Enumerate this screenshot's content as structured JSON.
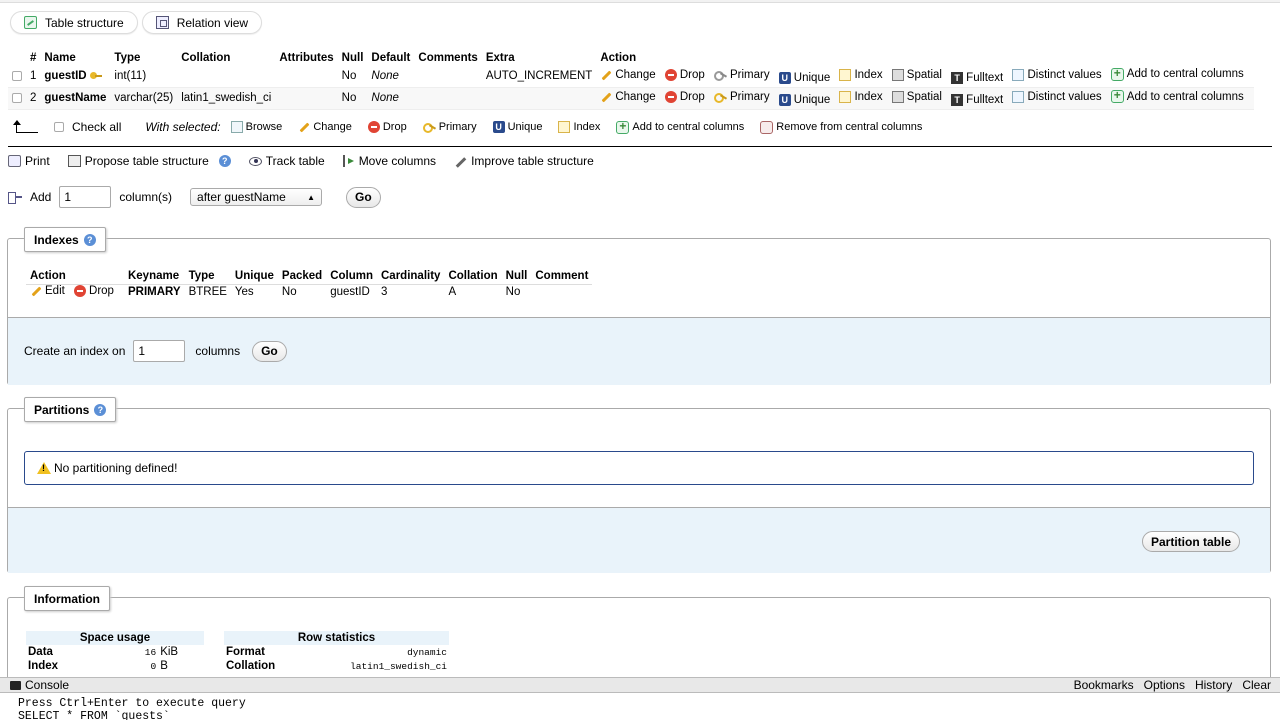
{
  "subtabs": [
    {
      "label": "Table structure",
      "icon": "structure-icon"
    },
    {
      "label": "Relation view",
      "icon": "relation-icon"
    }
  ],
  "structure": {
    "headers": [
      "#",
      "Name",
      "Type",
      "Collation",
      "Attributes",
      "Null",
      "Default",
      "Comments",
      "Extra",
      "Action"
    ],
    "rows": [
      {
        "num": "1",
        "name": "guestID",
        "type": "int(11)",
        "collation": "",
        "attributes": "",
        "null": "No",
        "default": "None",
        "comments": "",
        "extra": "AUTO_INCREMENT"
      },
      {
        "num": "2",
        "name": "guestName",
        "type": "varchar(25)",
        "collation": "latin1_swedish_ci",
        "attributes": "",
        "null": "No",
        "default": "None",
        "comments": "",
        "extra": ""
      }
    ],
    "actions": [
      "Change",
      "Drop",
      "Primary",
      "Unique",
      "Index",
      "Spatial",
      "Fulltext",
      "Distinct values",
      "Add to central columns"
    ]
  },
  "with_selected": {
    "check_all": "Check all",
    "label": "With selected:",
    "buttons": [
      "Browse",
      "Change",
      "Drop",
      "Primary",
      "Unique",
      "Index",
      "Add to central columns",
      "Remove from central columns"
    ]
  },
  "toollinks": [
    "Print",
    "Propose table structure",
    "Track table",
    "Move columns",
    "Improve table structure"
  ],
  "add_column": {
    "label": "Add",
    "value": "1",
    "suffix": "column(s)",
    "position": "after guestName",
    "go": "Go"
  },
  "indexes": {
    "legend": "Indexes",
    "headers": [
      "Action",
      "Keyname",
      "Type",
      "Unique",
      "Packed",
      "Column",
      "Cardinality",
      "Collation",
      "Null",
      "Comment"
    ],
    "row": {
      "edit": "Edit",
      "drop": "Drop",
      "keyname": "PRIMARY",
      "type": "BTREE",
      "unique": "Yes",
      "packed": "No",
      "column": "guestID",
      "cardinality": "3",
      "collation": "A",
      "null": "No",
      "comment": ""
    },
    "create": {
      "label": "Create an index on",
      "value": "1",
      "suffix": "columns",
      "go": "Go"
    }
  },
  "partitions": {
    "legend": "Partitions",
    "notice": "No partitioning defined!",
    "button": "Partition table"
  },
  "information": {
    "legend": "Information",
    "space_usage": {
      "title": "Space usage",
      "rows": [
        {
          "label": "Data",
          "value": "16",
          "unit": "KiB"
        },
        {
          "label": "Index",
          "value": "0",
          "unit": "B"
        }
      ]
    },
    "row_statistics": {
      "title": "Row statistics",
      "rows": [
        {
          "label": "Format",
          "value": "dynamic"
        },
        {
          "label": "Collation",
          "value": "latin1_swedish_ci"
        }
      ]
    }
  },
  "console": {
    "label": "Console",
    "links": [
      "Bookmarks",
      "Options",
      "History",
      "Clear"
    ],
    "hint": "Press Ctrl+Enter to execute query",
    "query": "SELECT * FROM `guests`"
  }
}
